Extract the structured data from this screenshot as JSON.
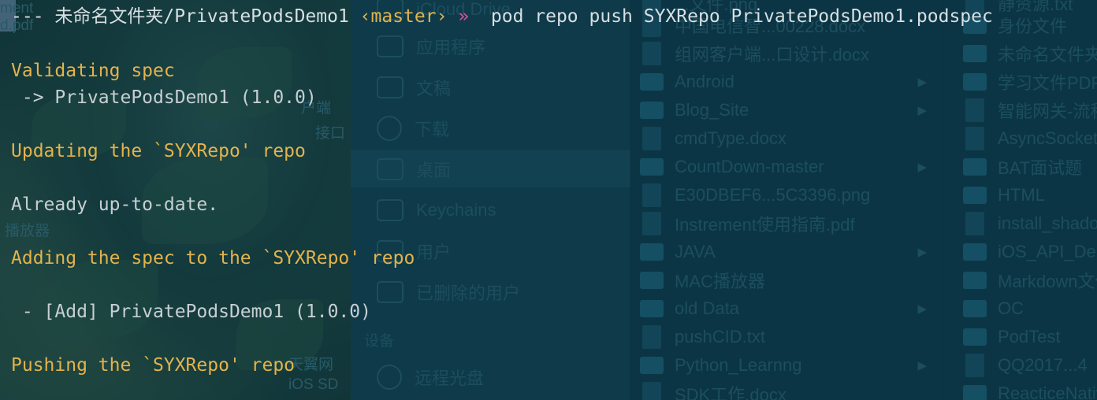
{
  "terminal": {
    "prompt": {
      "dashes": "---",
      "path": "未命名文件夹/PrivatePodsDemo1",
      "branch": "‹master›",
      "arrow": "»",
      "command": "pod repo push SYXRepo PrivatePodsDemo1.podspec"
    },
    "output": [
      {
        "text": "Validating spec",
        "color": "yellow"
      },
      {
        "text": " -> PrivatePodsDemo1 (1.0.0)",
        "color": "gray"
      },
      {
        "text": "Updating the `SYXRepo' repo",
        "color": "yellow"
      },
      {
        "text": "Already up-to-date.",
        "color": "gray"
      },
      {
        "text": "Adding the spec to the `SYXRepo' repo",
        "color": "yellow"
      },
      {
        "text": " - [Add] PrivatePodsDemo1 (1.0.0)",
        "color": "gray"
      },
      {
        "text": "Pushing the `SYXRepo' repo",
        "color": "yellow"
      }
    ]
  },
  "background": {
    "desktop_labels": [
      "ment",
      "d.pdf",
      "户端",
      "接口",
      "播放器",
      "天翼网",
      "iOS SD"
    ],
    "finder_sidebar": {
      "items": [
        "iCloud Drive",
        "应用程序",
        "文稿",
        "下载",
        "桌面",
        "Keychains",
        "用户",
        "已删除的用户"
      ],
      "selected": "桌面",
      "devices_header": "设备",
      "devices": [
        "远程光盘"
      ]
    },
    "column1": [
      {
        "name": "...文件.png",
        "kind": "file"
      },
      {
        "name": "中国电信智...00228.docx",
        "kind": "doc"
      },
      {
        "name": "组网客户端...口设计.docx",
        "kind": "doc"
      },
      {
        "name": "Android",
        "kind": "folder"
      },
      {
        "name": "Blog_Site",
        "kind": "folder"
      },
      {
        "name": "cmdType.docx",
        "kind": "doc"
      },
      {
        "name": "CountDown-master",
        "kind": "folder"
      },
      {
        "name": "E30DBEF6...5C3396.png",
        "kind": "file"
      },
      {
        "name": "Instrement使用指南.pdf",
        "kind": "file"
      },
      {
        "name": "JAVA",
        "kind": "folder"
      },
      {
        "name": "MAC播放器",
        "kind": "file"
      },
      {
        "name": "old Data",
        "kind": "folder"
      },
      {
        "name": "pushCID.txt",
        "kind": "file"
      },
      {
        "name": "Python_Learnng",
        "kind": "folder"
      },
      {
        "name": "SDK工作.docx",
        "kind": "doc"
      }
    ],
    "column2": [
      {
        "name": "静资源.txt",
        "kind": "doc"
      },
      {
        "name": "身份文件",
        "kind": "folder"
      },
      {
        "name": "未命名文件夹",
        "kind": "folder"
      },
      {
        "name": "学习文件PDF",
        "kind": "folder"
      },
      {
        "name": "智能网关-流程",
        "kind": "doc"
      },
      {
        "name": "AsyncSocket",
        "kind": "doc"
      },
      {
        "name": "BAT面试题",
        "kind": "folder"
      },
      {
        "name": "HTML",
        "kind": "folder"
      },
      {
        "name": "install_shadowsocks",
        "kind": "doc"
      },
      {
        "name": "iOS_API_Demo",
        "kind": "folder"
      },
      {
        "name": "Markdown文件",
        "kind": "folder"
      },
      {
        "name": "OC",
        "kind": "folder"
      },
      {
        "name": "PodTest",
        "kind": "folder"
      },
      {
        "name": "QQ2017...4",
        "kind": "doc"
      },
      {
        "name": "ReacticeNative",
        "kind": "folder"
      }
    ]
  }
}
